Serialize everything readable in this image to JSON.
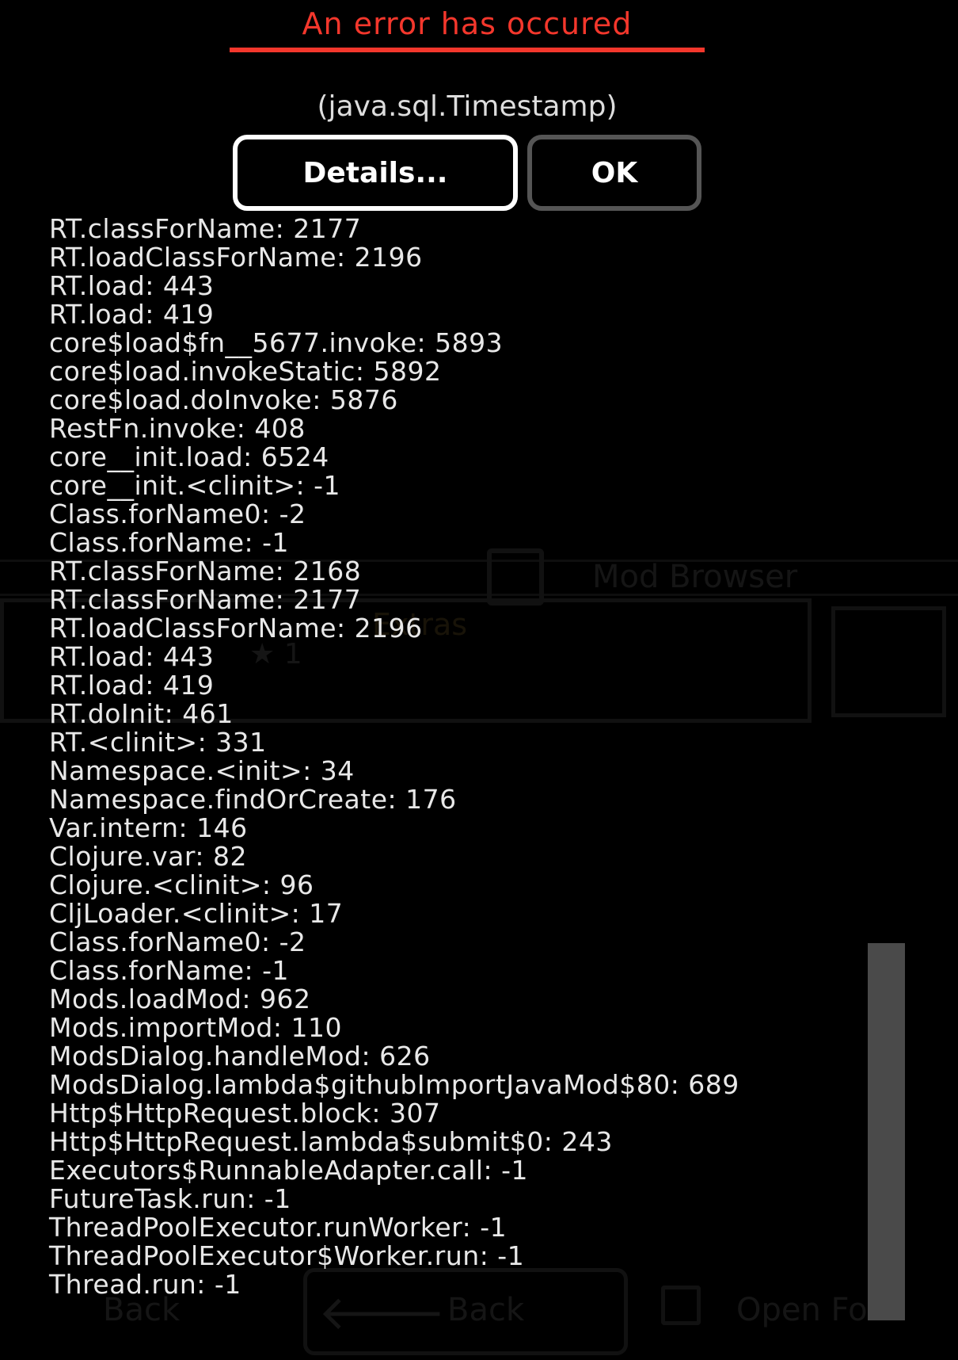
{
  "background": {
    "header_title": "Mod Browser",
    "card_title": "Extras",
    "card_stars": "★ 1",
    "footer_left": "Back",
    "footer_back_label": "Back",
    "footer_open_label": "Open Fo"
  },
  "dialog": {
    "title": "An error has occured",
    "message": "(java.sql.Timestamp)",
    "details_button": "Details...",
    "ok_button": "OK"
  },
  "stack_trace": [
    "RT.classForName: 2177",
    "RT.loadClassForName: 2196",
    "RT.load: 443",
    "RT.load: 419",
    "core$load$fn__5677.invoke: 5893",
    "core$load.invokeStatic: 5892",
    "core$load.doInvoke: 5876",
    "RestFn.invoke: 408",
    "core__init.load: 6524",
    "core__init.<clinit>: -1",
    "Class.forName0: -2",
    "Class.forName: -1",
    "RT.classForName: 2168",
    "RT.classForName: 2177",
    "RT.loadClassForName: 2196",
    "RT.load: 443",
    "RT.load: 419",
    "RT.doInit: 461",
    "RT.<clinit>: 331",
    "Namespace.<init>: 34",
    "Namespace.findOrCreate: 176",
    "Var.intern: 146",
    "Clojure.var: 82",
    "Clojure.<clinit>: 96",
    "CljLoader.<clinit>: 17",
    "Class.forName0: -2",
    "Class.forName: -1",
    "Mods.loadMod: 962",
    "Mods.importMod: 110",
    "ModsDialog.handleMod: 626",
    "ModsDialog.lambda$githubImportJavaMod$80: 689",
    "Http$HttpRequest.block: 307",
    "Http$HttpRequest.lambda$submit$0: 243",
    "Executors$RunnableAdapter.call: -1",
    "FutureTask.run: -1",
    "ThreadPoolExecutor.runWorker: -1",
    "ThreadPoolExecutor$Worker.run: -1",
    "Thread.run: -1"
  ],
  "colors": {
    "title_red": "#f4372c",
    "background": "#000000",
    "text": "#e8e8e8",
    "scrollbar": "#4a4a4a"
  }
}
